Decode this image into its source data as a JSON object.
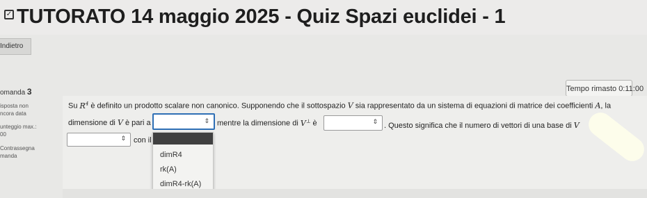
{
  "header": {
    "title": "TUTORATO 14 maggio 2025 - Quiz Spazi euclidei - 1"
  },
  "nav": {
    "back_label": "Indietro"
  },
  "timer": {
    "label": "Tempo rimasto 0:11:00"
  },
  "sidebar": {
    "question_label": "omanda",
    "question_number": "3",
    "status_1": "isposta non",
    "status_2": "ncora data",
    "points_label": "unteggio max.:",
    "points_value": "00",
    "flag_1": "Contrassegna",
    "flag_2": "manda"
  },
  "question": {
    "part1_prefix": "Su",
    "space_symbol": "R",
    "space_exp": "4",
    "part1_text": "è definito un prodotto scalare non canonico. Supponendo che il sottospazio",
    "v_symbol": "V",
    "part1_tail": "sia rappresentato da un sistema di equazioni di matrice dei coefficienti",
    "a_symbol": "A",
    "part1_end": ", la",
    "part2_prefix": "dimensione di",
    "part2_mid": "è pari a",
    "part2_after": "mentre la dimensione di",
    "perp_symbol": "V",
    "perp_sup": "⊥",
    "part2_e": "è",
    "part2_tail": ". Questo significa che il numero di vettori di una base di",
    "part3_text": "con il"
  },
  "dropdown": {
    "options": [
      "dimR4",
      "rk(A)",
      "dimR4-rk(A)"
    ]
  },
  "icons": {
    "title": "quiz-icon",
    "select_arrow": "updown-arrow-icon"
  }
}
